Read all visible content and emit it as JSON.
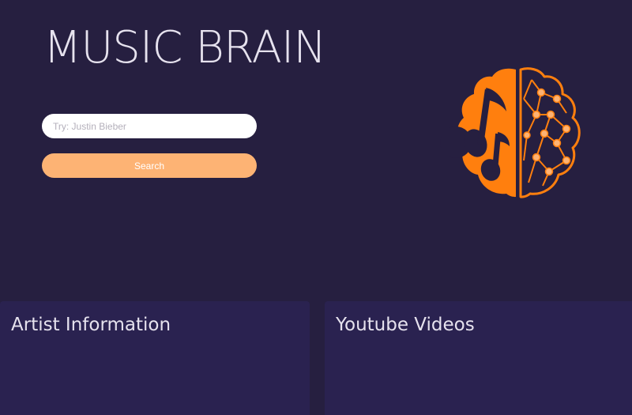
{
  "header": {
    "title": "MUSIC BRAIN"
  },
  "search": {
    "placeholder": "Try: Justin Bieber",
    "value": "",
    "button_label": "Search"
  },
  "logo": {
    "icon": "music-brain-logo-icon",
    "colors": {
      "left_half": "#ff7f0e",
      "network_lines": "#ff7f0e",
      "nodes": "#fdb374",
      "notes": "#261f40"
    }
  },
  "panels": {
    "artist_title": "Artist Information",
    "youtube_title": "Youtube Videos"
  },
  "colors": {
    "background": "#261f40",
    "panel": "#2a2250",
    "accent": "#fdb374",
    "text": "#e6e2ee"
  }
}
